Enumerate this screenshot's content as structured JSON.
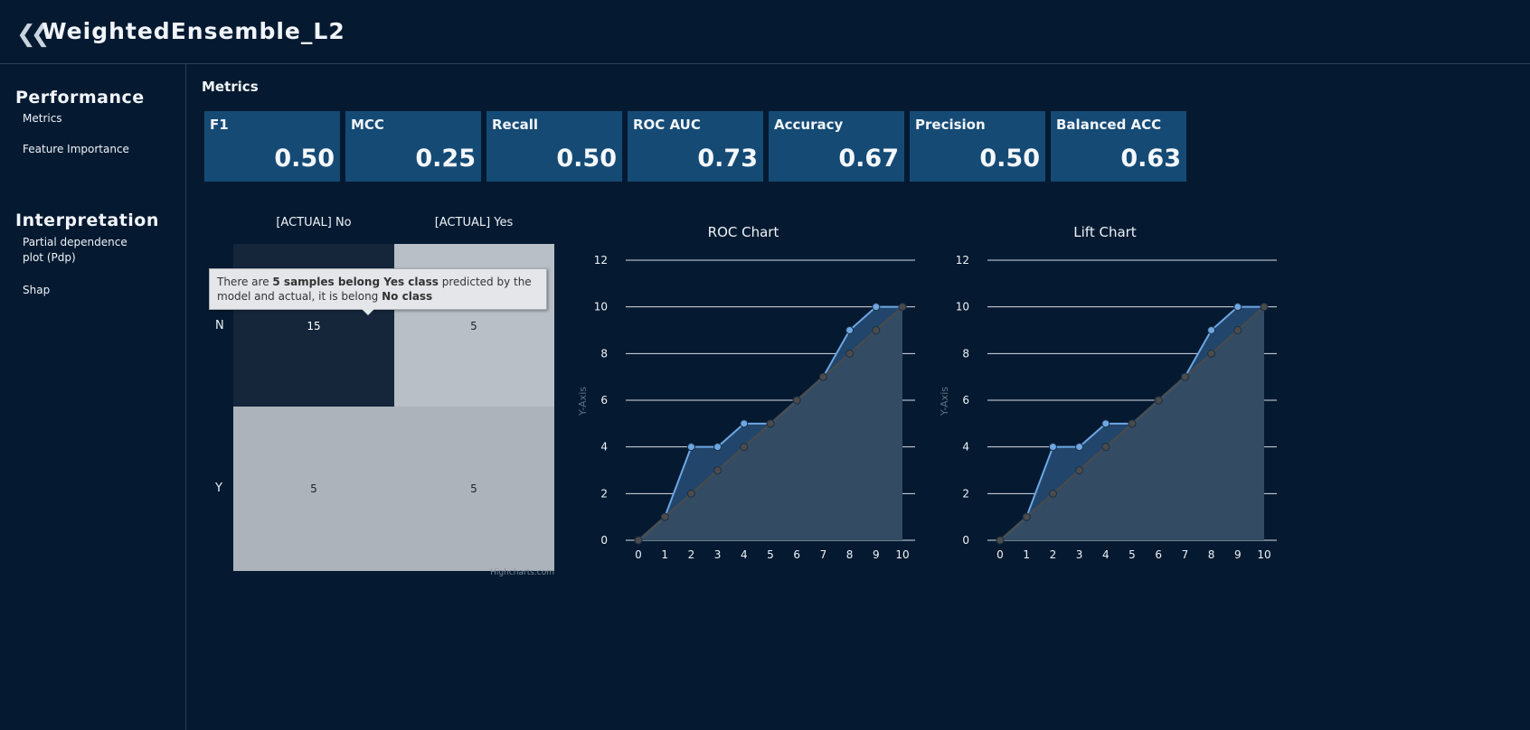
{
  "header": {
    "back_icon": "double-chevron-left-icon",
    "title": "WeightedEnsemble_L2"
  },
  "sidebar": {
    "sections": [
      {
        "title": "Performance",
        "items": [
          {
            "label": "Metrics"
          },
          {
            "label": "Feature Importance"
          }
        ]
      },
      {
        "title": "Interpretation",
        "items": [
          {
            "label": "Partial dependence plot (Pdp)"
          },
          {
            "label": "Shap"
          }
        ]
      }
    ]
  },
  "main": {
    "section_title": "Metrics",
    "metrics": [
      {
        "label": "F1",
        "value": "0.50"
      },
      {
        "label": "MCC",
        "value": "0.25"
      },
      {
        "label": "Recall",
        "value": "0.50"
      },
      {
        "label": "ROC AUC",
        "value": "0.73"
      },
      {
        "label": "Accuracy",
        "value": "0.67"
      },
      {
        "label": "Precision",
        "value": "0.50"
      },
      {
        "label": "Balanced ACC",
        "value": "0.63"
      }
    ]
  },
  "colors": {
    "background": "#051a31",
    "card": "#154a75",
    "line_blue": "#6da7e4",
    "line_gray": "#4b4b4b"
  },
  "chart_data": [
    {
      "type": "heatmap",
      "title": "",
      "x_categories": [
        "[ACTUAL] No",
        "[ACTUAL] Yes"
      ],
      "y_categories": [
        "N",
        "Y"
      ],
      "values": [
        [
          15,
          5
        ],
        [
          5,
          5
        ]
      ],
      "credits": "Highcharts.com",
      "tooltip": {
        "prefix": "There are ",
        "bold1": "5 samples belong Yes class",
        "middle": " predicted by the model and actual, it is belong ",
        "bold2": "No class"
      }
    },
    {
      "type": "area",
      "title": "ROC Chart",
      "ylabel": "Y-Axis",
      "x": [
        0,
        1,
        2,
        3,
        4,
        5,
        6,
        7,
        8,
        9,
        10
      ],
      "ylim": [
        0,
        12
      ],
      "yticks": [
        0,
        2,
        4,
        6,
        8,
        10,
        12
      ],
      "grid": true,
      "series": [
        {
          "values": [
            0,
            1,
            4,
            4,
            5,
            5,
            6,
            7,
            9,
            10,
            10
          ],
          "color": "#6da7e4"
        },
        {
          "values": [
            0,
            1,
            2,
            3,
            4,
            5,
            6,
            7,
            8,
            9,
            10
          ],
          "color": "#4b4b4b"
        }
      ]
    },
    {
      "type": "area",
      "title": "Lift Chart",
      "ylabel": "Y-Axis",
      "x": [
        0,
        1,
        2,
        3,
        4,
        5,
        6,
        7,
        8,
        9,
        10
      ],
      "ylim": [
        0,
        12
      ],
      "yticks": [
        0,
        2,
        4,
        6,
        8,
        10,
        12
      ],
      "grid": true,
      "series": [
        {
          "values": [
            0,
            1,
            4,
            4,
            5,
            5,
            6,
            7,
            9,
            10,
            10
          ],
          "color": "#6da7e4"
        },
        {
          "values": [
            0,
            1,
            2,
            3,
            4,
            5,
            6,
            7,
            8,
            9,
            10
          ],
          "color": "#4b4b4b"
        }
      ]
    }
  ]
}
